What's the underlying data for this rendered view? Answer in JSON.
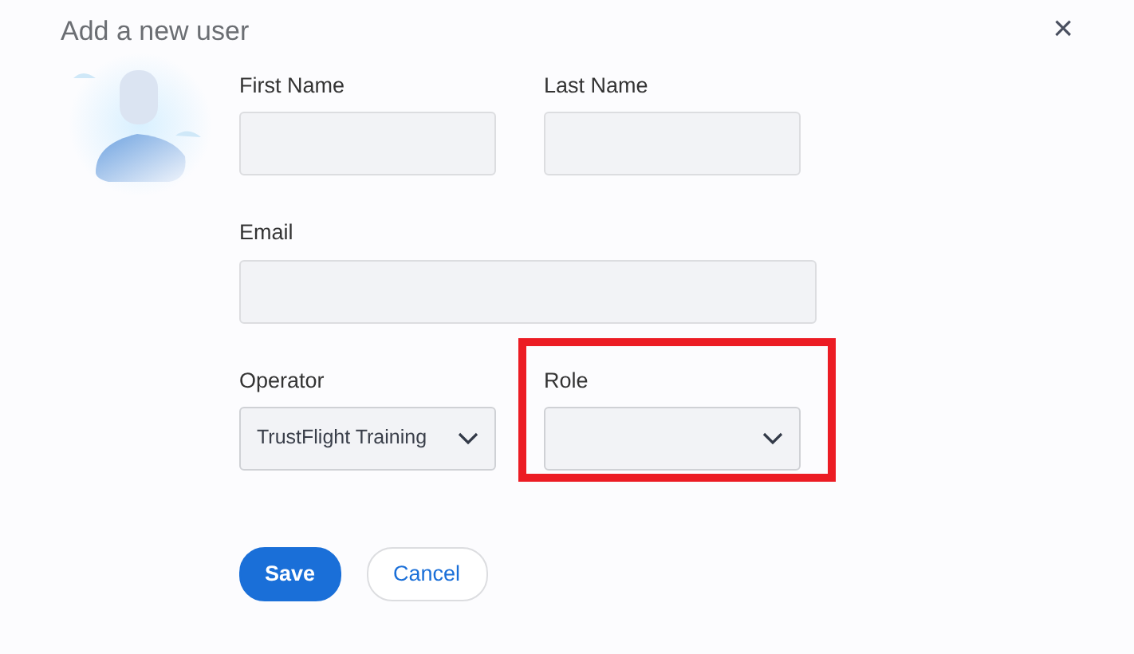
{
  "dialog": {
    "title": "Add a new user",
    "close": "×"
  },
  "fields": [
    {
      "kind": "text",
      "label": "First Name"
    },
    {
      "kind": "text",
      "label": "Last Name"
    },
    {
      "kind": "wide-text",
      "label": "Email"
    },
    {
      "kind": "select",
      "label": "Operator",
      "value": "TrustFlight Training"
    },
    {
      "kind": "select",
      "label": "Role",
      "highlighted": true
    }
  ],
  "buttons": [
    {
      "label": "Save",
      "kind": "primary"
    },
    {
      "label": "Cancel",
      "kind": "secondary"
    }
  ]
}
